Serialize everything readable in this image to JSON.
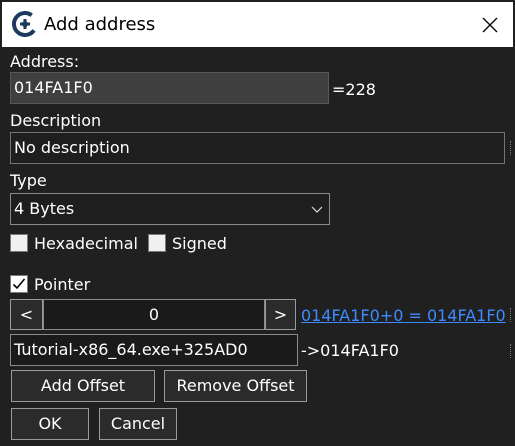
{
  "window": {
    "title": "Add address",
    "close_glyph": "✕"
  },
  "address": {
    "label": "Address:",
    "value": "014FA1F0",
    "equals_text": "=228"
  },
  "description": {
    "label": "Description",
    "value": "No description"
  },
  "type": {
    "label": "Type",
    "selected": "4 Bytes"
  },
  "options": {
    "hexadecimal_label": "Hexadecimal",
    "hexadecimal_checked": false,
    "signed_label": "Signed",
    "signed_checked": false
  },
  "pointer": {
    "label": "Pointer",
    "checked": true,
    "prev_label": "<",
    "next_label": ">",
    "offset_value": "0",
    "offset_result_link": "014FA1F0+0 = 014FA1F0",
    "base_address": "Tutorial-x86_64.exe+325AD0",
    "base_result": "->014FA1F0",
    "add_offset_label": "Add Offset",
    "remove_offset_label": "Remove Offset"
  },
  "buttons": {
    "ok_label": "OK",
    "cancel_label": "Cancel"
  },
  "icons": {
    "app_icon": "cheat-engine-icon",
    "close": "close-icon",
    "dropdown": "chevron-down-icon",
    "check": "checkmark-icon"
  },
  "colors": {
    "background": "#202020",
    "titlebar": "#ffffff",
    "link": "#3d8bff",
    "address_field": "#3f3f3f"
  }
}
